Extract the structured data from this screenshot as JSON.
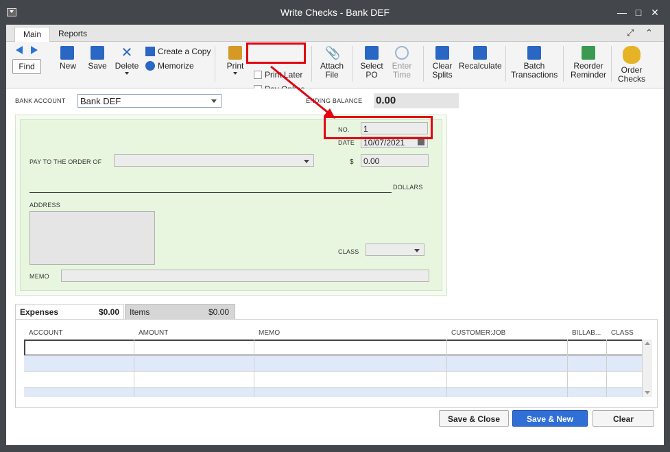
{
  "window": {
    "title": "Write Checks - Bank DEF"
  },
  "tabs": [
    "Main",
    "Reports"
  ],
  "toolbar": {
    "find": "Find",
    "new": "New",
    "save": "Save",
    "delete": "Delete",
    "create_copy": "Create a Copy",
    "memorize": "Memorize",
    "print": "Print",
    "print_later": "Print Later",
    "pay_online": "Pay Online",
    "attach_file": [
      "Attach",
      "File"
    ],
    "select_po": [
      "Select",
      "PO"
    ],
    "enter_time": [
      "Enter",
      "Time"
    ],
    "clear_splits": [
      "Clear",
      "Splits"
    ],
    "recalculate": "Recalculate",
    "batch_transactions": [
      "Batch",
      "Transactions"
    ],
    "reorder_reminder": [
      "Reorder",
      "Reminder"
    ],
    "order_checks": [
      "Order",
      "Checks"
    ]
  },
  "form": {
    "bank_account_label": "BANK ACCOUNT",
    "bank_account_value": "Bank DEF",
    "ending_balance_label": "ENDING BALANCE",
    "ending_balance_value": "0.00",
    "no_label": "NO.",
    "no_value": "1",
    "date_label": "DATE",
    "date_value": "10/07/2021",
    "pay_to_label": "PAY TO THE ORDER OF",
    "dollar_sign": "$",
    "amount_value": "0.00",
    "dollars_label": "DOLLARS",
    "address_label": "ADDRESS",
    "class_label": "CLASS",
    "memo_label": "MEMO"
  },
  "subtabs": [
    {
      "label": "Expenses",
      "amount": "$0.00"
    },
    {
      "label": "Items",
      "amount": "$0.00"
    }
  ],
  "grid": {
    "columns": [
      "ACCOUNT",
      "AMOUNT",
      "MEMO",
      "CUSTOMER:JOB",
      "BILLAB...",
      "CLASS"
    ]
  },
  "buttons": {
    "save_close": "Save & Close",
    "save_new": "Save & New",
    "clear": "Clear"
  },
  "colors": {
    "highlight": "#e3000f",
    "primary_button": "#2f6fd6",
    "check_background": "#e8f6e0"
  }
}
